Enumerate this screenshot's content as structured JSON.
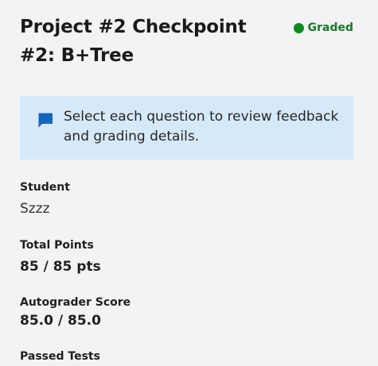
{
  "header": {
    "title": "Project #2 Checkpoint #2: B+Tree",
    "status": "Graded",
    "status_color": "#0f8a1f"
  },
  "notice": {
    "icon": "message-icon",
    "text": "Select each question to review feedback and grading details."
  },
  "fields": {
    "student_label": "Student",
    "student_value": "Szzz",
    "total_points_label": "Total Points",
    "total_points_value": "85 / 85 pts",
    "autograder_label": "Autograder Score",
    "autograder_value": "85.0 / 85.0",
    "passed_tests_label": "Passed Tests"
  }
}
